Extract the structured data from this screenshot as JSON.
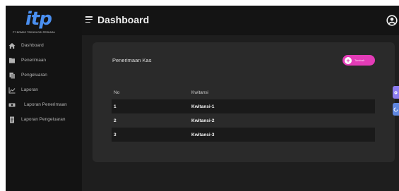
{
  "brand": {
    "logo_text": "itp",
    "logo_subtitle": "PT BOMKO TEKNOLOGI PERKASA",
    "logo_color": "#4a8ff0"
  },
  "sidebar": {
    "items": [
      {
        "label": "Dashboard",
        "icon": "home-icon"
      },
      {
        "label": "Penerimaan",
        "icon": "folder-icon"
      },
      {
        "label": "Pengeluaran",
        "icon": "copy-icon"
      },
      {
        "label": "Laporan",
        "icon": "chart-icon"
      },
      {
        "label": "Laporan Penerimaan",
        "icon": "money-icon"
      },
      {
        "label": "Laporan Pengeluaran",
        "icon": "document-icon"
      }
    ]
  },
  "header": {
    "title": "Dashboard",
    "menu_icon": "hamburger-icon",
    "user_icon": "user-icon"
  },
  "card": {
    "title": "Penerimaan Kas",
    "add_button_label": "Tambah",
    "add_button_color": "#e33cb7",
    "table": {
      "headers": {
        "no": "No",
        "kwitansi": "Kwitansi"
      },
      "rows": [
        {
          "no": "1",
          "kwitansi": "Kwitansi-1"
        },
        {
          "no": "2",
          "kwitansi": "Kwitansi-2"
        },
        {
          "no": "3",
          "kwitansi": "Kwitansi-3"
        }
      ]
    }
  },
  "colors": {
    "background": "#1e1e1e",
    "sidebar": "#131313",
    "card": "#2a2a2a",
    "row_stripe": "#1a1a1a",
    "side_tab_1": "#8c7cf0",
    "side_tab_2": "#5f86e0"
  }
}
